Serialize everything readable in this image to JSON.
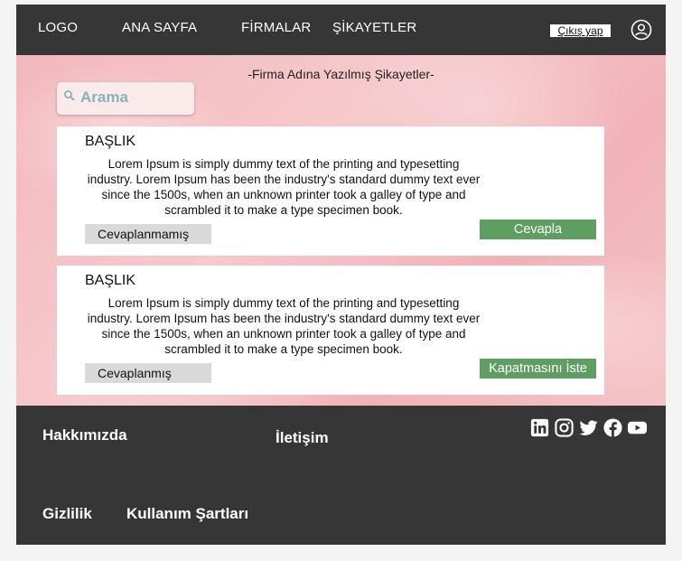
{
  "header": {
    "logo": "LOGO",
    "nav": [
      "ANA SAYFA",
      "FİRMALAR",
      "ŞİKAYETLER"
    ],
    "logout_label": "Çıkış yap"
  },
  "main": {
    "title": "-Firma Adına Yazılmış Şikayetler-",
    "search_placeholder": "Arama",
    "complaints": [
      {
        "title": "BAŞLIK",
        "body": "Lorem Ipsum is simply dummy text of the printing and typesetting industry. Lorem Ipsum has been the industry's standard dummy text ever since the 1500s, when an unknown printer took a galley of type and scrambled it to make a type specimen book.",
        "status": "Cevaplanmamış",
        "action": "Cevapla"
      },
      {
        "title": "BAŞLIK",
        "body": "Lorem Ipsum is simply dummy text of the printing and typesetting industry. Lorem Ipsum has been the industry's standard dummy text ever since the 1500s, when an unknown printer took a galley of type and scrambled it to make a type specimen book.",
        "status": "Cevaplanmış",
        "action": "Kapatmasını İste"
      }
    ]
  },
  "footer": {
    "about": "Hakkımızda",
    "contact": "İletişim",
    "privacy": "Gizlilik",
    "terms": "Kullanım Şartları",
    "social_icons": [
      "linkedin-icon",
      "instagram-icon",
      "twitter-icon",
      "facebook-icon",
      "youtube-icon"
    ]
  },
  "colors": {
    "bar": "#363636",
    "accent_green": "#5e9e60",
    "status_gray": "#d9d9d9",
    "search_text": "#86b3b8"
  }
}
